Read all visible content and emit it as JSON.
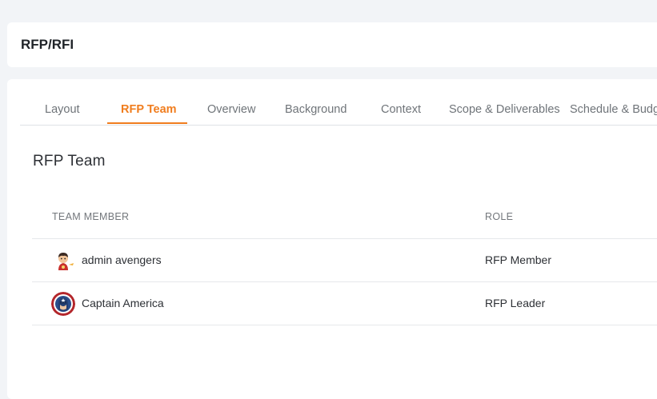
{
  "page": {
    "title": "RFP/RFI"
  },
  "tabs": [
    {
      "label": "Layout",
      "active": false
    },
    {
      "label": "RFP Team",
      "active": true
    },
    {
      "label": "Overview",
      "active": false
    },
    {
      "label": "Background",
      "active": false
    },
    {
      "label": "Context",
      "active": false
    },
    {
      "label": "Scope & Deliverables",
      "active": false
    },
    {
      "label": "Schedule & Budg",
      "active": false
    }
  ],
  "section": {
    "title": "RFP Team"
  },
  "team_table": {
    "columns": [
      "TEAM MEMBER",
      "ROLE"
    ],
    "rows": [
      {
        "member": "admin avengers",
        "role": "RFP Member",
        "avatar": "iron-man-avatar"
      },
      {
        "member": "Captain America",
        "role": "RFP Leader",
        "avatar": "captain-america-avatar"
      }
    ]
  },
  "colors": {
    "accent": "#f07d1e",
    "background": "#f2f4f7",
    "card": "#ffffff"
  }
}
